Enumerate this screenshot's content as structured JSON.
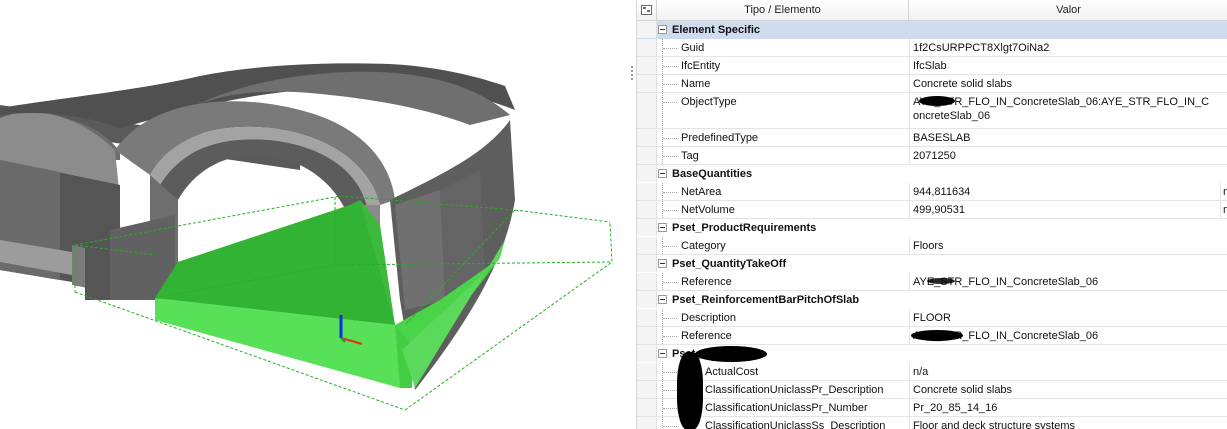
{
  "viewport": {
    "colors": {
      "model_dark": "#4a4a4a",
      "model_mid": "#6a6a6a",
      "model_light": "#a9a9a9",
      "slab_green": "#3fc93f",
      "slab_green_light": "#66e866",
      "bbox_dashed": "#22b022",
      "axis_red": "#e03020",
      "axis_blue": "#1030e0",
      "axis_green": "#20a020"
    }
  },
  "properties_panel": {
    "columns": {
      "name": "Tipo / Elemento",
      "value": "Valor"
    },
    "groups": [
      {
        "name": "Element Specific",
        "selected": true,
        "properties": [
          {
            "name": "Guid",
            "value": "1f2CsURPPCT8Xlgt7OiNa2"
          },
          {
            "name": "IfcEntity",
            "value": "IfcSlab"
          },
          {
            "name": "Name",
            "value": "Concrete solid slabs"
          },
          {
            "name": "ObjectType",
            "value": "AYE_STR_FLO_IN_ConcreteSlab_06:AYE_STR_FLO_IN_ConcreteSlab_06",
            "tall": true
          },
          {
            "name": "PredefinedType",
            "value": "BASESLAB"
          },
          {
            "name": "Tag",
            "value": "2071250"
          }
        ]
      },
      {
        "name": "BaseQuantities",
        "properties": [
          {
            "name": "NetArea",
            "value": "944,811634",
            "unit": "m"
          },
          {
            "name": "NetVolume",
            "value": "499,90531",
            "unit": "m"
          }
        ]
      },
      {
        "name": "Pset_ProductRequirements",
        "properties": [
          {
            "name": "Category",
            "value": "Floors"
          }
        ]
      },
      {
        "name": "Pset_QuantityTakeOff",
        "properties": [
          {
            "name": "Reference",
            "value": "AYE_STR_FLO_IN_ConcreteSlab_06"
          }
        ]
      },
      {
        "name": "Pset_ReinforcementBarPitchOfSlab",
        "properties": [
          {
            "name": "Description",
            "value": "FLOOR"
          },
          {
            "name": "Reference",
            "value": "AYE_STR_FLO_IN_ConcreteSlab_06"
          }
        ]
      },
      {
        "name": "Pset_          Parameters",
        "properties": [
          {
            "name": "ActualCost",
            "value": "n/a"
          },
          {
            "name": "ClassificationUniclassPr_Description",
            "value": "Concrete solid slabs"
          },
          {
            "name": "ClassificationUniclassPr_Number",
            "value": "Pr_20_85_14_16"
          },
          {
            "name": "ClassificationUniclassSs_Description",
            "value": "Floor and deck structure systems"
          }
        ]
      }
    ]
  }
}
